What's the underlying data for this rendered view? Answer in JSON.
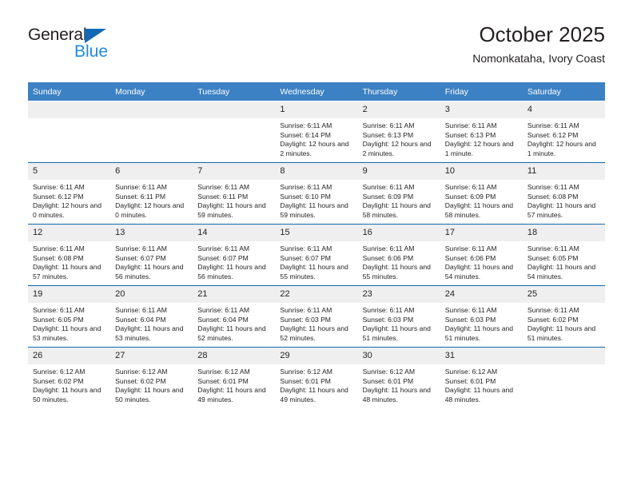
{
  "logo": {
    "word1": "General",
    "word2": "Blue",
    "triangle_color": "#1268b3",
    "word2_color": "#1f8ae0",
    "icon": "triangle-icon"
  },
  "header": {
    "title": "October 2025",
    "subtitle": "Nomonkataha, Ivory Coast"
  },
  "theme": {
    "header_bar": "#3c81c4",
    "row_rule": "#1268b3",
    "day_number_band": "#efefef",
    "text": "#231f20"
  },
  "weekday_headers": [
    "Sunday",
    "Monday",
    "Tuesday",
    "Wednesday",
    "Thursday",
    "Friday",
    "Saturday"
  ],
  "weeks": [
    [
      {
        "day": "",
        "sunrise": "",
        "sunset": "",
        "daylight": ""
      },
      {
        "day": "",
        "sunrise": "",
        "sunset": "",
        "daylight": ""
      },
      {
        "day": "",
        "sunrise": "",
        "sunset": "",
        "daylight": ""
      },
      {
        "day": "1",
        "sunrise": "Sunrise: 6:11 AM",
        "sunset": "Sunset: 6:14 PM",
        "daylight": "Daylight: 12 hours and 2 minutes."
      },
      {
        "day": "2",
        "sunrise": "Sunrise: 6:11 AM",
        "sunset": "Sunset: 6:13 PM",
        "daylight": "Daylight: 12 hours and 2 minutes."
      },
      {
        "day": "3",
        "sunrise": "Sunrise: 6:11 AM",
        "sunset": "Sunset: 6:13 PM",
        "daylight": "Daylight: 12 hours and 1 minute."
      },
      {
        "day": "4",
        "sunrise": "Sunrise: 6:11 AM",
        "sunset": "Sunset: 6:12 PM",
        "daylight": "Daylight: 12 hours and 1 minute."
      }
    ],
    [
      {
        "day": "5",
        "sunrise": "Sunrise: 6:11 AM",
        "sunset": "Sunset: 6:12 PM",
        "daylight": "Daylight: 12 hours and 0 minutes."
      },
      {
        "day": "6",
        "sunrise": "Sunrise: 6:11 AM",
        "sunset": "Sunset: 6:11 PM",
        "daylight": "Daylight: 12 hours and 0 minutes."
      },
      {
        "day": "7",
        "sunrise": "Sunrise: 6:11 AM",
        "sunset": "Sunset: 6:11 PM",
        "daylight": "Daylight: 11 hours and 59 minutes."
      },
      {
        "day": "8",
        "sunrise": "Sunrise: 6:11 AM",
        "sunset": "Sunset: 6:10 PM",
        "daylight": "Daylight: 11 hours and 59 minutes."
      },
      {
        "day": "9",
        "sunrise": "Sunrise: 6:11 AM",
        "sunset": "Sunset: 6:09 PM",
        "daylight": "Daylight: 11 hours and 58 minutes."
      },
      {
        "day": "10",
        "sunrise": "Sunrise: 6:11 AM",
        "sunset": "Sunset: 6:09 PM",
        "daylight": "Daylight: 11 hours and 58 minutes."
      },
      {
        "day": "11",
        "sunrise": "Sunrise: 6:11 AM",
        "sunset": "Sunset: 6:08 PM",
        "daylight": "Daylight: 11 hours and 57 minutes."
      }
    ],
    [
      {
        "day": "12",
        "sunrise": "Sunrise: 6:11 AM",
        "sunset": "Sunset: 6:08 PM",
        "daylight": "Daylight: 11 hours and 57 minutes."
      },
      {
        "day": "13",
        "sunrise": "Sunrise: 6:11 AM",
        "sunset": "Sunset: 6:07 PM",
        "daylight": "Daylight: 11 hours and 56 minutes."
      },
      {
        "day": "14",
        "sunrise": "Sunrise: 6:11 AM",
        "sunset": "Sunset: 6:07 PM",
        "daylight": "Daylight: 11 hours and 56 minutes."
      },
      {
        "day": "15",
        "sunrise": "Sunrise: 6:11 AM",
        "sunset": "Sunset: 6:07 PM",
        "daylight": "Daylight: 11 hours and 55 minutes."
      },
      {
        "day": "16",
        "sunrise": "Sunrise: 6:11 AM",
        "sunset": "Sunset: 6:06 PM",
        "daylight": "Daylight: 11 hours and 55 minutes."
      },
      {
        "day": "17",
        "sunrise": "Sunrise: 6:11 AM",
        "sunset": "Sunset: 6:06 PM",
        "daylight": "Daylight: 11 hours and 54 minutes."
      },
      {
        "day": "18",
        "sunrise": "Sunrise: 6:11 AM",
        "sunset": "Sunset: 6:05 PM",
        "daylight": "Daylight: 11 hours and 54 minutes."
      }
    ],
    [
      {
        "day": "19",
        "sunrise": "Sunrise: 6:11 AM",
        "sunset": "Sunset: 6:05 PM",
        "daylight": "Daylight: 11 hours and 53 minutes."
      },
      {
        "day": "20",
        "sunrise": "Sunrise: 6:11 AM",
        "sunset": "Sunset: 6:04 PM",
        "daylight": "Daylight: 11 hours and 53 minutes."
      },
      {
        "day": "21",
        "sunrise": "Sunrise: 6:11 AM",
        "sunset": "Sunset: 6:04 PM",
        "daylight": "Daylight: 11 hours and 52 minutes."
      },
      {
        "day": "22",
        "sunrise": "Sunrise: 6:11 AM",
        "sunset": "Sunset: 6:03 PM",
        "daylight": "Daylight: 11 hours and 52 minutes."
      },
      {
        "day": "23",
        "sunrise": "Sunrise: 6:11 AM",
        "sunset": "Sunset: 6:03 PM",
        "daylight": "Daylight: 11 hours and 51 minutes."
      },
      {
        "day": "24",
        "sunrise": "Sunrise: 6:11 AM",
        "sunset": "Sunset: 6:03 PM",
        "daylight": "Daylight: 11 hours and 51 minutes."
      },
      {
        "day": "25",
        "sunrise": "Sunrise: 6:11 AM",
        "sunset": "Sunset: 6:02 PM",
        "daylight": "Daylight: 11 hours and 51 minutes."
      }
    ],
    [
      {
        "day": "26",
        "sunrise": "Sunrise: 6:12 AM",
        "sunset": "Sunset: 6:02 PM",
        "daylight": "Daylight: 11 hours and 50 minutes."
      },
      {
        "day": "27",
        "sunrise": "Sunrise: 6:12 AM",
        "sunset": "Sunset: 6:02 PM",
        "daylight": "Daylight: 11 hours and 50 minutes."
      },
      {
        "day": "28",
        "sunrise": "Sunrise: 6:12 AM",
        "sunset": "Sunset: 6:01 PM",
        "daylight": "Daylight: 11 hours and 49 minutes."
      },
      {
        "day": "29",
        "sunrise": "Sunrise: 6:12 AM",
        "sunset": "Sunset: 6:01 PM",
        "daylight": "Daylight: 11 hours and 49 minutes."
      },
      {
        "day": "30",
        "sunrise": "Sunrise: 6:12 AM",
        "sunset": "Sunset: 6:01 PM",
        "daylight": "Daylight: 11 hours and 48 minutes."
      },
      {
        "day": "31",
        "sunrise": "Sunrise: 6:12 AM",
        "sunset": "Sunset: 6:01 PM",
        "daylight": "Daylight: 11 hours and 48 minutes."
      },
      {
        "day": "",
        "sunrise": "",
        "sunset": "",
        "daylight": ""
      }
    ]
  ]
}
